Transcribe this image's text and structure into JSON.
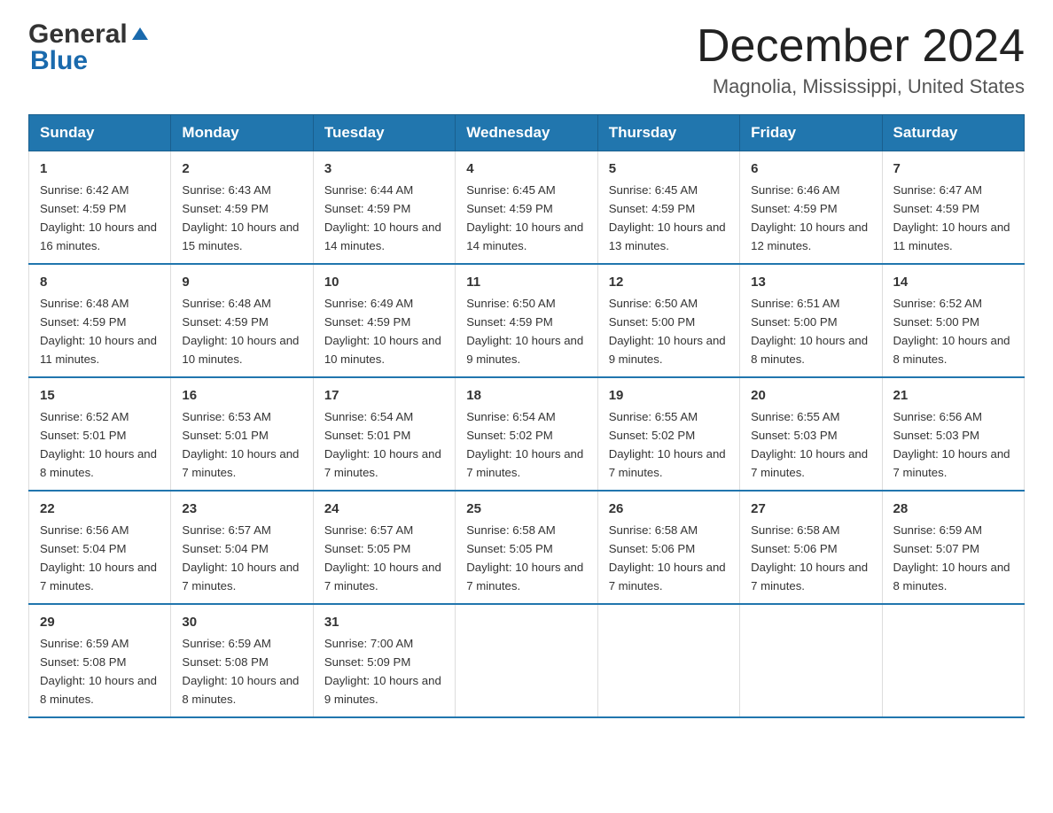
{
  "header": {
    "logo_general": "General",
    "logo_blue": "Blue",
    "title": "December 2024",
    "subtitle": "Magnolia, Mississippi, United States"
  },
  "weekdays": [
    "Sunday",
    "Monday",
    "Tuesday",
    "Wednesday",
    "Thursday",
    "Friday",
    "Saturday"
  ],
  "weeks": [
    [
      {
        "day": "1",
        "sunrise": "6:42 AM",
        "sunset": "4:59 PM",
        "daylight": "10 hours and 16 minutes."
      },
      {
        "day": "2",
        "sunrise": "6:43 AM",
        "sunset": "4:59 PM",
        "daylight": "10 hours and 15 minutes."
      },
      {
        "day": "3",
        "sunrise": "6:44 AM",
        "sunset": "4:59 PM",
        "daylight": "10 hours and 14 minutes."
      },
      {
        "day": "4",
        "sunrise": "6:45 AM",
        "sunset": "4:59 PM",
        "daylight": "10 hours and 14 minutes."
      },
      {
        "day": "5",
        "sunrise": "6:45 AM",
        "sunset": "4:59 PM",
        "daylight": "10 hours and 13 minutes."
      },
      {
        "day": "6",
        "sunrise": "6:46 AM",
        "sunset": "4:59 PM",
        "daylight": "10 hours and 12 minutes."
      },
      {
        "day": "7",
        "sunrise": "6:47 AM",
        "sunset": "4:59 PM",
        "daylight": "10 hours and 11 minutes."
      }
    ],
    [
      {
        "day": "8",
        "sunrise": "6:48 AM",
        "sunset": "4:59 PM",
        "daylight": "10 hours and 11 minutes."
      },
      {
        "day": "9",
        "sunrise": "6:48 AM",
        "sunset": "4:59 PM",
        "daylight": "10 hours and 10 minutes."
      },
      {
        "day": "10",
        "sunrise": "6:49 AM",
        "sunset": "4:59 PM",
        "daylight": "10 hours and 10 minutes."
      },
      {
        "day": "11",
        "sunrise": "6:50 AM",
        "sunset": "4:59 PM",
        "daylight": "10 hours and 9 minutes."
      },
      {
        "day": "12",
        "sunrise": "6:50 AM",
        "sunset": "5:00 PM",
        "daylight": "10 hours and 9 minutes."
      },
      {
        "day": "13",
        "sunrise": "6:51 AM",
        "sunset": "5:00 PM",
        "daylight": "10 hours and 8 minutes."
      },
      {
        "day": "14",
        "sunrise": "6:52 AM",
        "sunset": "5:00 PM",
        "daylight": "10 hours and 8 minutes."
      }
    ],
    [
      {
        "day": "15",
        "sunrise": "6:52 AM",
        "sunset": "5:01 PM",
        "daylight": "10 hours and 8 minutes."
      },
      {
        "day": "16",
        "sunrise": "6:53 AM",
        "sunset": "5:01 PM",
        "daylight": "10 hours and 7 minutes."
      },
      {
        "day": "17",
        "sunrise": "6:54 AM",
        "sunset": "5:01 PM",
        "daylight": "10 hours and 7 minutes."
      },
      {
        "day": "18",
        "sunrise": "6:54 AM",
        "sunset": "5:02 PM",
        "daylight": "10 hours and 7 minutes."
      },
      {
        "day": "19",
        "sunrise": "6:55 AM",
        "sunset": "5:02 PM",
        "daylight": "10 hours and 7 minutes."
      },
      {
        "day": "20",
        "sunrise": "6:55 AM",
        "sunset": "5:03 PM",
        "daylight": "10 hours and 7 minutes."
      },
      {
        "day": "21",
        "sunrise": "6:56 AM",
        "sunset": "5:03 PM",
        "daylight": "10 hours and 7 minutes."
      }
    ],
    [
      {
        "day": "22",
        "sunrise": "6:56 AM",
        "sunset": "5:04 PM",
        "daylight": "10 hours and 7 minutes."
      },
      {
        "day": "23",
        "sunrise": "6:57 AM",
        "sunset": "5:04 PM",
        "daylight": "10 hours and 7 minutes."
      },
      {
        "day": "24",
        "sunrise": "6:57 AM",
        "sunset": "5:05 PM",
        "daylight": "10 hours and 7 minutes."
      },
      {
        "day": "25",
        "sunrise": "6:58 AM",
        "sunset": "5:05 PM",
        "daylight": "10 hours and 7 minutes."
      },
      {
        "day": "26",
        "sunrise": "6:58 AM",
        "sunset": "5:06 PM",
        "daylight": "10 hours and 7 minutes."
      },
      {
        "day": "27",
        "sunrise": "6:58 AM",
        "sunset": "5:06 PM",
        "daylight": "10 hours and 7 minutes."
      },
      {
        "day": "28",
        "sunrise": "6:59 AM",
        "sunset": "5:07 PM",
        "daylight": "10 hours and 8 minutes."
      }
    ],
    [
      {
        "day": "29",
        "sunrise": "6:59 AM",
        "sunset": "5:08 PM",
        "daylight": "10 hours and 8 minutes."
      },
      {
        "day": "30",
        "sunrise": "6:59 AM",
        "sunset": "5:08 PM",
        "daylight": "10 hours and 8 minutes."
      },
      {
        "day": "31",
        "sunrise": "7:00 AM",
        "sunset": "5:09 PM",
        "daylight": "10 hours and 9 minutes."
      },
      null,
      null,
      null,
      null
    ]
  ],
  "labels": {
    "sunrise": "Sunrise:",
    "sunset": "Sunset:",
    "daylight": "Daylight:"
  }
}
